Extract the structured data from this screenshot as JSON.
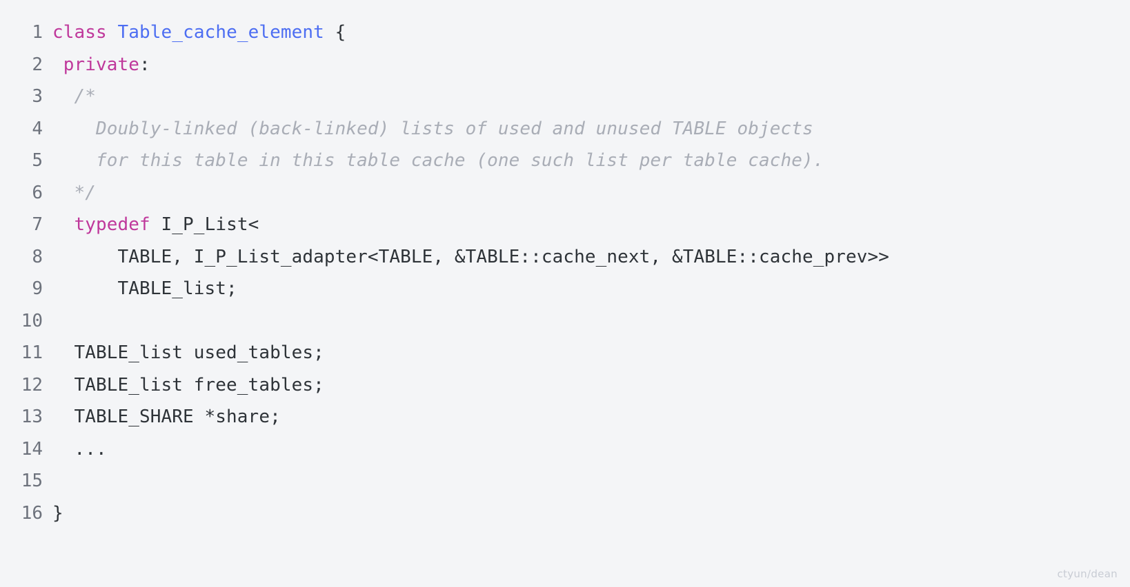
{
  "viewer": {
    "background_color": "#f4f5f7",
    "language": "cpp",
    "watermark": "ctyun/dean"
  },
  "colors": {
    "keyword": "#bf389b",
    "type": "#4d6ef2",
    "comment": "#a9adb6",
    "plain": "#2e3338",
    "line_number": "#6d727c",
    "background": "#f4f5f7",
    "watermark": "#c8ccd4"
  },
  "code": {
    "lines": [
      {
        "number": "1",
        "text": "class Table_cache_element {",
        "tokens": [
          {
            "t": "class",
            "k": "keyword"
          },
          {
            "t": " ",
            "k": "plain"
          },
          {
            "t": "Table_cache_element",
            "k": "type"
          },
          {
            "t": " {",
            "k": "punct"
          }
        ]
      },
      {
        "number": "2",
        "text": " private:",
        "tokens": [
          {
            "t": " ",
            "k": "plain"
          },
          {
            "t": "private",
            "k": "keyword"
          },
          {
            "t": ":",
            "k": "punct"
          }
        ]
      },
      {
        "number": "3",
        "text": "  /*",
        "tokens": [
          {
            "t": "  ",
            "k": "plain"
          },
          {
            "t": "/*",
            "k": "comment"
          }
        ]
      },
      {
        "number": "4",
        "text": "    Doubly-linked (back-linked) lists of used and unused TABLE objects",
        "tokens": [
          {
            "t": "  ",
            "k": "plain"
          },
          {
            "t": "  Doubly-linked (back-linked) lists of used and unused TABLE objects",
            "k": "comment"
          }
        ]
      },
      {
        "number": "5",
        "text": "    for this table in this table cache (one such list per table cache).",
        "tokens": [
          {
            "t": "  ",
            "k": "plain"
          },
          {
            "t": "  for this table in this table cache (one such list per table cache).",
            "k": "comment"
          }
        ]
      },
      {
        "number": "6",
        "text": "  */",
        "tokens": [
          {
            "t": "  ",
            "k": "plain"
          },
          {
            "t": "*/",
            "k": "comment"
          }
        ]
      },
      {
        "number": "7",
        "text": "  typedef I_P_List<",
        "tokens": [
          {
            "t": "  ",
            "k": "plain"
          },
          {
            "t": "typedef",
            "k": "keyword"
          },
          {
            "t": " I_P_List<",
            "k": "plain"
          }
        ]
      },
      {
        "number": "8",
        "text": "      TABLE, I_P_List_adapter<TABLE, &TABLE::cache_next, &TABLE::cache_prev>>",
        "tokens": [
          {
            "t": "      TABLE, I_P_List_adapter<TABLE, &TABLE::cache_next, &TABLE::cache_prev>>",
            "k": "plain"
          }
        ]
      },
      {
        "number": "9",
        "text": "      TABLE_list;",
        "tokens": [
          {
            "t": "      TABLE_list;",
            "k": "plain"
          }
        ]
      },
      {
        "number": "10",
        "text": "",
        "tokens": []
      },
      {
        "number": "11",
        "text": "  TABLE_list used_tables;",
        "tokens": [
          {
            "t": "  TABLE_list used_tables;",
            "k": "plain"
          }
        ]
      },
      {
        "number": "12",
        "text": "  TABLE_list free_tables;",
        "tokens": [
          {
            "t": "  TABLE_list free_tables;",
            "k": "plain"
          }
        ]
      },
      {
        "number": "13",
        "text": "  TABLE_SHARE *share;",
        "tokens": [
          {
            "t": "  TABLE_SHARE *share;",
            "k": "plain"
          }
        ]
      },
      {
        "number": "14",
        "text": "  ...",
        "tokens": [
          {
            "t": "  ...",
            "k": "plain"
          }
        ]
      },
      {
        "number": "15",
        "text": "",
        "tokens": []
      },
      {
        "number": "16",
        "text": "}",
        "tokens": [
          {
            "t": "}",
            "k": "punct"
          }
        ]
      }
    ]
  }
}
